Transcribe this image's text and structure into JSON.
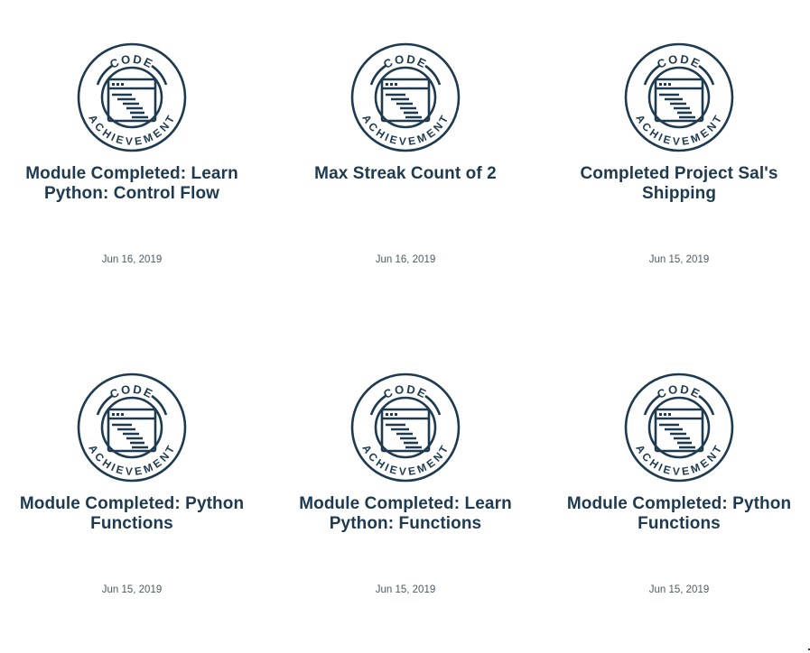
{
  "badge": {
    "top_text": "CODE",
    "bottom_text": "ACHIEVEMENT",
    "icon": "code-window-icon",
    "color": "#1e3a50"
  },
  "achievements": [
    {
      "title": "Module Completed: Learn Python: Control Flow",
      "date": "Jun 16, 2019"
    },
    {
      "title": "Max Streak Count of 2",
      "date": "Jun 16, 2019"
    },
    {
      "title": "Completed Project Sal's Shipping",
      "date": "Jun 15, 2019"
    },
    {
      "title": "Module Completed: Python Functions",
      "date": "Jun 15, 2019"
    },
    {
      "title": "Module Completed: Learn Python: Functions",
      "date": "Jun 15, 2019"
    },
    {
      "title": "Module Completed: Python Functions",
      "date": "Jun 15, 2019"
    }
  ]
}
